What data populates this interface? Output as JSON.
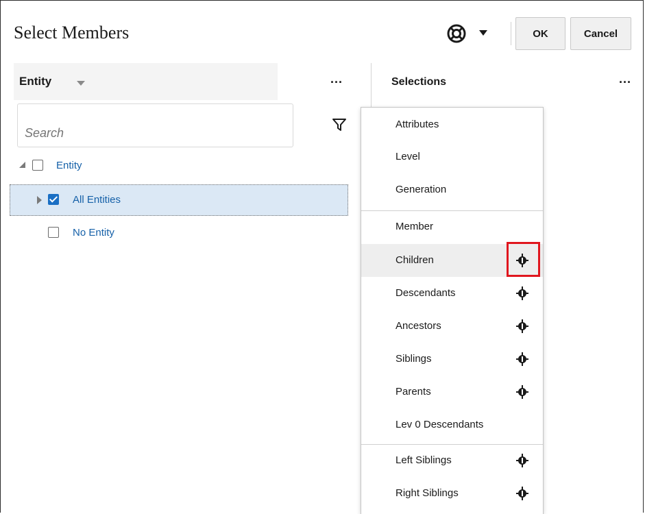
{
  "dialog": {
    "title": "Select Members"
  },
  "header": {
    "help_icon": "lifebuoy-icon",
    "ok_label": "OK",
    "cancel_label": "Cancel"
  },
  "left_pane": {
    "dimension_label": "Entity",
    "more_label": "...",
    "search_placeholder": "Search",
    "filter_icon": "filter-icon",
    "tree": [
      {
        "label": "Entity",
        "checked": false,
        "expanded": true
      },
      {
        "label": "All Entities",
        "checked": true,
        "expanded": false,
        "selected": true
      },
      {
        "label": "No Entity",
        "checked": false
      }
    ]
  },
  "right_pane": {
    "selections_label": "Selections",
    "more_label": "..."
  },
  "menu": {
    "items": [
      {
        "label": "Attributes",
        "has_icon": false
      },
      {
        "label": "Level",
        "has_icon": false
      },
      {
        "label": "Generation",
        "has_icon": false
      },
      {
        "label": "Member",
        "has_icon": false
      },
      {
        "label": "Children",
        "has_icon": true,
        "highlighted": true
      },
      {
        "label": "Descendants",
        "has_icon": true
      },
      {
        "label": "Ancestors",
        "has_icon": true
      },
      {
        "label": "Siblings",
        "has_icon": true
      },
      {
        "label": "Parents",
        "has_icon": true
      },
      {
        "label": "Lev 0 Descendants",
        "has_icon": false
      },
      {
        "label": "Left Siblings",
        "has_icon": true
      },
      {
        "label": "Right Siblings",
        "has_icon": true
      }
    ],
    "item_icon": "inclusive-member-icon",
    "highlight_color": "#e0161e"
  }
}
